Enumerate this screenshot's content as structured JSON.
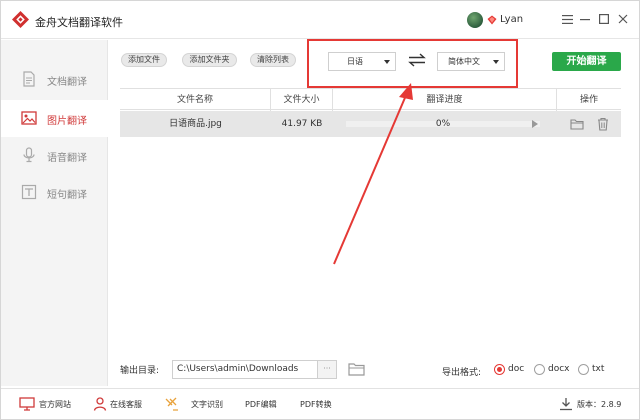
{
  "app": {
    "title": "金舟文档翻译软件",
    "user_name": "Lyan",
    "window_controls": [
      "minimize",
      "restore",
      "close"
    ],
    "menu_icon": "hamburger-menu"
  },
  "sidebar": {
    "items": [
      {
        "label": "文档翻译",
        "icon": "document-icon",
        "active": false
      },
      {
        "label": "图片翻译",
        "icon": "image-icon",
        "active": true
      },
      {
        "label": "语音翻译",
        "icon": "microphone-icon",
        "active": false
      },
      {
        "label": "短句翻译",
        "icon": "text-icon",
        "active": false
      }
    ]
  },
  "toolbar": {
    "add_file": "添加文件",
    "add_folder": "添加文件夹",
    "clear_list": "清除列表",
    "source_lang": "日语",
    "target_lang": "简体中文",
    "start": "开始翻译"
  },
  "table": {
    "headers": {
      "name": "文件名称",
      "size": "文件大小",
      "progress": "翻译进度",
      "actions": "操作"
    },
    "rows": [
      {
        "name": "日语商品.jpg",
        "size": "41.97 KB",
        "progress_text": "0%",
        "progress": 0
      }
    ]
  },
  "output": {
    "dir_label": "输出目录:",
    "dir_value": "C:\\Users\\admin\\Downloads",
    "more": "···",
    "format_label": "导出格式:",
    "formats": [
      "doc",
      "docx",
      "txt"
    ],
    "selected_format": "doc"
  },
  "footer": {
    "website": "官方网站",
    "support": "在线客服",
    "ocr": "文字识别",
    "pdf_edit": "PDF编辑",
    "pdf_convert": "PDF转换",
    "version": "版本：2.8.9"
  },
  "colors": {
    "accent_red": "#d03a3a",
    "highlight_red": "#e53935",
    "start_green": "#2aa84a"
  }
}
